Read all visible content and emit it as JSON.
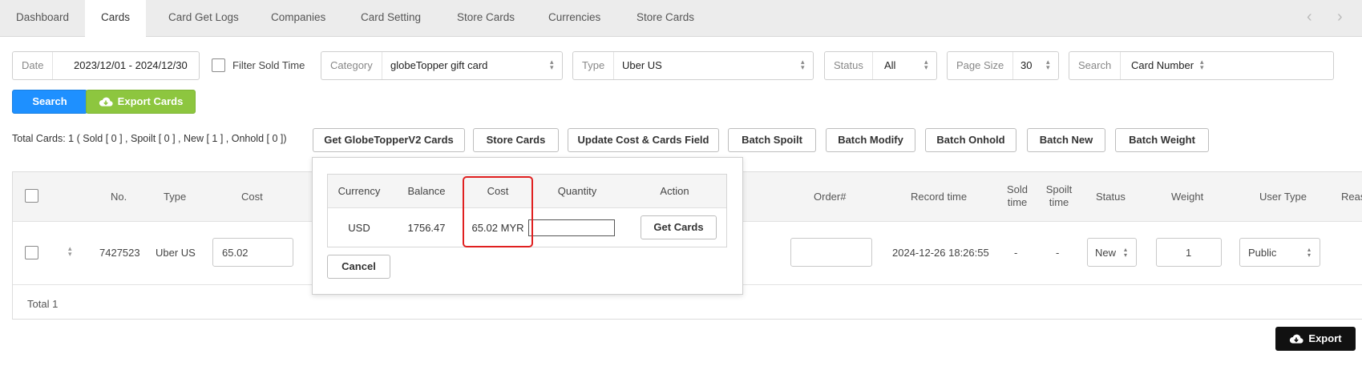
{
  "tabs": [
    {
      "label": "Dashboard",
      "active": false
    },
    {
      "label": "Cards",
      "active": true
    },
    {
      "label": "Card Get Logs",
      "active": false
    },
    {
      "label": "Companies",
      "active": false
    },
    {
      "label": "Card Setting",
      "active": false
    },
    {
      "label": "Store Cards",
      "active": false
    },
    {
      "label": "Currencies",
      "active": false
    },
    {
      "label": "Store Cards",
      "active": false
    }
  ],
  "nav": {
    "prev_icon": "chevron-left-icon",
    "next_icon": "chevron-right-icon"
  },
  "filters": {
    "date_label": "Date",
    "date_value": "2023/12/01 - 2024/12/30",
    "filter_sold_time": "Filter Sold Time",
    "category_label": "Category",
    "category_value": "globeTopper gift card",
    "type_label": "Type",
    "type_value": "Uber US",
    "status_label": "Status",
    "status_value": "All",
    "page_size_label": "Page Size",
    "page_size_value": "30",
    "search_label": "Search",
    "search_field_value": "Card Number"
  },
  "actions": {
    "search": "Search",
    "export_cards": "Export Cards"
  },
  "summary": "Total Cards: 1 ( Sold [ 0 ] , Spoilt [ 0 ] , New [ 1 ] , Onhold [ 0 ])",
  "batch_buttons": [
    "Get GlobeTopperV2 Cards",
    "Store Cards",
    "Update Cost & Cards Field",
    "Batch Spoilt",
    "Batch Modify",
    "Batch Onhold",
    "Batch New",
    "Batch Weight"
  ],
  "table": {
    "headers": {
      "no": "No.",
      "type": "Type",
      "cost": "Cost",
      "order": "Order#",
      "record_time": "Record time",
      "sold_time": "Sold time",
      "spoilt_time": "Spoilt time",
      "status": "Status",
      "weight": "Weight",
      "user_type": "User Type",
      "reason": "Reas"
    },
    "row": {
      "no": "7427523",
      "type": "Uber US",
      "cost": "65.02",
      "order": "",
      "record_time": "2024-12-26 18:26:55",
      "sold_time": "-",
      "spoilt_time": "-",
      "status": "New",
      "weight": "1",
      "user_type": "Public"
    },
    "total": "Total 1"
  },
  "popup": {
    "headers": {
      "currency": "Currency",
      "balance": "Balance",
      "cost": "Cost",
      "quantity": "Quantity",
      "action": "Action"
    },
    "row": {
      "currency": "USD",
      "balance": "1756.47",
      "cost": "65.02 MYR",
      "quantity": "",
      "action": "Get Cards"
    },
    "cancel": "Cancel"
  },
  "footer": {
    "export": "Export"
  },
  "colors": {
    "primary": "#1e90ff",
    "success": "#8dc63f",
    "highlight": "#e02020",
    "dark": "#111111"
  }
}
